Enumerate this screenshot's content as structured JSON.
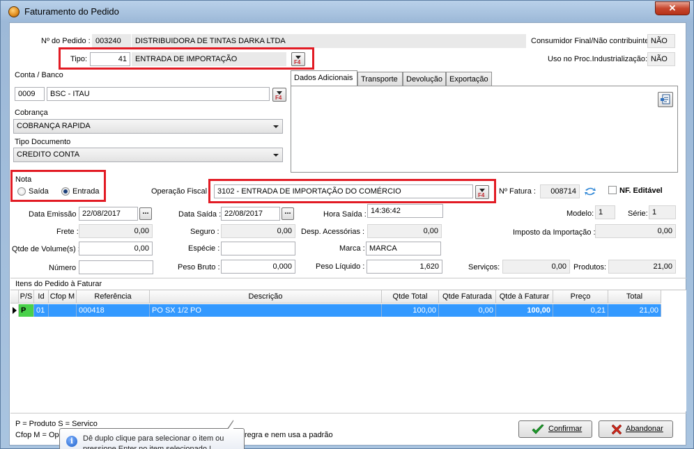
{
  "window": {
    "title": "Faturamento do Pedido",
    "close_label": "✕"
  },
  "pedido": {
    "label": "Nº do Pedido :",
    "number": "003240",
    "customer": "DISTRIBUIDORA DE TINTAS DARKA LTDA"
  },
  "consumidor_final": {
    "label": "Consumidor Final/Não contribuinte:",
    "value": "NÃO"
  },
  "uso_proc": {
    "label": "Uso no Proc.Industrialização:",
    "value": "NÃO"
  },
  "tipo": {
    "label": "Tipo:",
    "code": "41",
    "description": "ENTRADA DE IMPORTAÇÃO",
    "fkey": "F4"
  },
  "conta_banco": {
    "label": "Conta / Banco",
    "code": "0009",
    "description": "BSC - ITAU",
    "fkey": "F4"
  },
  "cobranca": {
    "label": "Cobrança",
    "value": "COBRANÇA RAPIDA"
  },
  "tipo_documento": {
    "label": "Tipo Documento",
    "value": "CREDITO CONTA"
  },
  "tabs": [
    {
      "label": "Dados Adicionais"
    },
    {
      "label": "Transporte"
    },
    {
      "label": "Devolução"
    },
    {
      "label": "Exportação"
    }
  ],
  "nota": {
    "label": "Nota",
    "saida": "Saída",
    "entrada": "Entrada",
    "selected": "Entrada"
  },
  "operacao_fiscal": {
    "label": "Operação Fiscal",
    "value": "3102 - ENTRADA DE IMPORTAÇÃO DO COMÉRCIO",
    "fkey": "F4"
  },
  "fatura": {
    "label": "Nº Fatura :",
    "value": "008714"
  },
  "nf_editavel": {
    "label": "NF. Editável"
  },
  "fields": {
    "data_emissao": {
      "label": "Data Emissão :",
      "value": "22/08/2017"
    },
    "data_saida": {
      "label": "Data Saída :",
      "value": "22/08/2017"
    },
    "hora_saida": {
      "label": "Hora Saída :",
      "value": "14:36:42"
    },
    "modelo": {
      "label": "Modelo:",
      "value": "1"
    },
    "serie": {
      "label": "Série:",
      "value": "1"
    },
    "frete": {
      "label": "Frete :",
      "value": "0,00"
    },
    "seguro": {
      "label": "Seguro :",
      "value": "0,00"
    },
    "desp_acessorias": {
      "label": "Desp. Acessórias :",
      "value": "0,00"
    },
    "imposto_importacao": {
      "label": "Imposto da Importação :",
      "value": "0,00"
    },
    "qtde_volumes": {
      "label": "Qtde de Volume(s) :",
      "value": "0,00"
    },
    "especie": {
      "label": "Espécie :",
      "value": ""
    },
    "marca": {
      "label": "Marca :",
      "value": "MARCA"
    },
    "numero": {
      "label": "Número :",
      "value": ""
    },
    "peso_bruto": {
      "label": "Peso Bruto :",
      "value": "0,000"
    },
    "peso_liquido": {
      "label": "Peso Líquido :",
      "value": "1,620"
    },
    "servicos": {
      "label": "Serviços:",
      "value": "0,00"
    },
    "produtos": {
      "label": "Produtos:",
      "value": "21,00"
    }
  },
  "itens": {
    "title": "Itens do Pedido à Faturar",
    "columns": [
      "P/S",
      "Id",
      "Cfop M",
      "Referência",
      "Descrição",
      "Qtde Total",
      "Qtde Faturada",
      "Qtde à Faturar",
      "Preço",
      "Total"
    ],
    "rows": [
      {
        "ps": "P",
        "id": "01",
        "cfop": "",
        "referencia": "000418",
        "descricao": "PO SX 1/2 PO",
        "qtde_total": "100,00",
        "qtde_faturada": "0,00",
        "qtde_faturar": "100,00",
        "preco": "0,21",
        "total": "21,00"
      }
    ]
  },
  "legend": {
    "line1": "P = Produto S = Servico",
    "line2_start": "Cfop M = Ope",
    "line2_end": "regra e nem usa a padrão"
  },
  "tooltip": {
    "text": "Dê duplo clique para selecionar o item ou pressione Enter no item selecionado !"
  },
  "buttons": {
    "confirmar": "Confirmar",
    "abandonar": "Abandonar"
  },
  "colors": {
    "selection": "#3399ff",
    "highlight": "#e21b24",
    "ps_cell": "#49d14a"
  }
}
